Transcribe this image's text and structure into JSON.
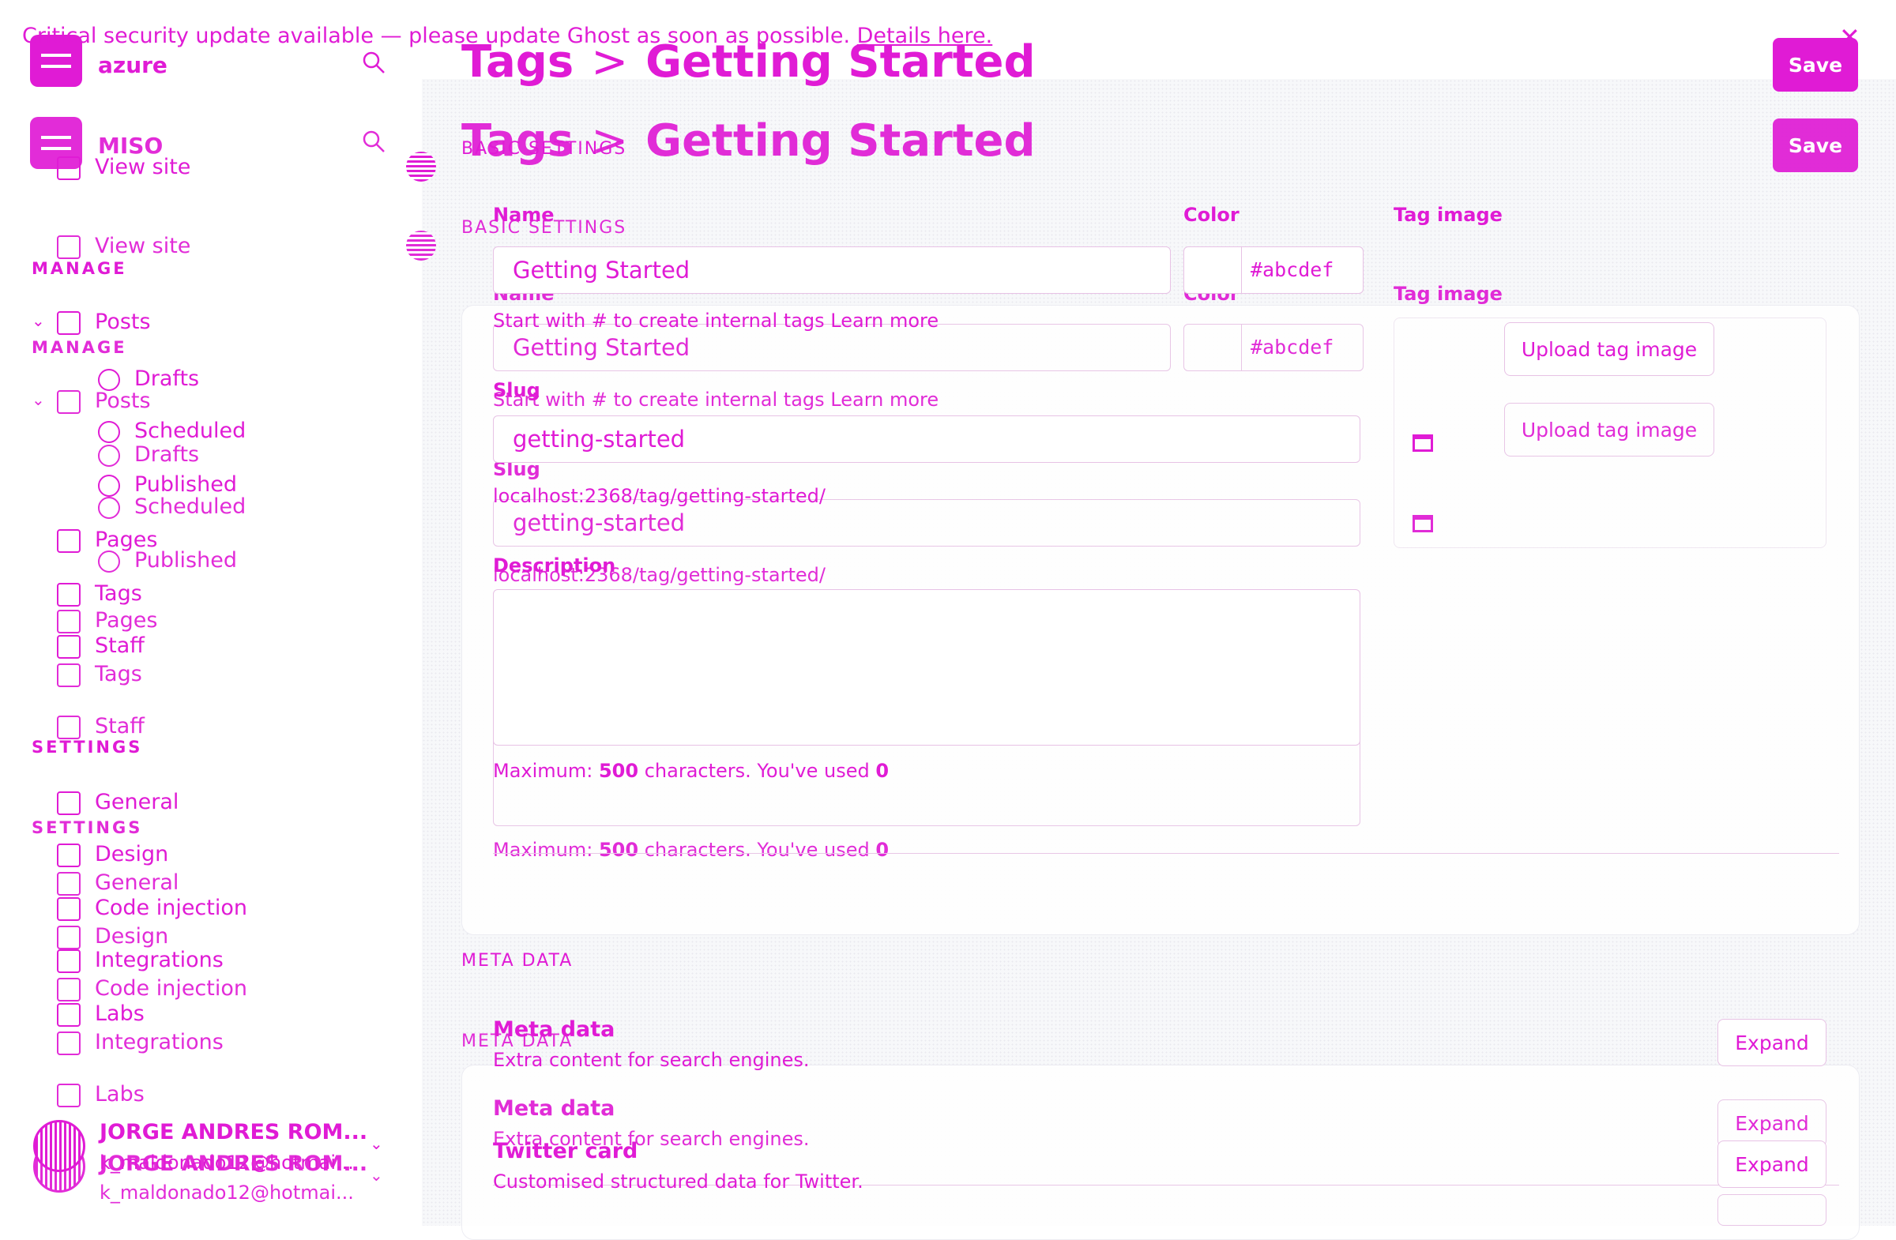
{
  "banner": {
    "text": "Critical security update available — please update Ghost as soon as possible.",
    "link": "Details here.",
    "close_icon": "close-icon"
  },
  "sidebar_primary": {
    "site_name": "azure",
    "view_site": "View site",
    "manage_heading": "MANAGE",
    "posts": "Posts",
    "drafts": "Drafts",
    "scheduled": "Scheduled",
    "published": "Published",
    "pages": "Pages",
    "tags": "Tags",
    "staff": "Staff",
    "settings_heading": "SETTINGS",
    "general": "General",
    "design": "Design",
    "code_injection": "Code injection",
    "integrations": "Integrations",
    "labs": "Labs",
    "user_name": "JORGE ANDRES ROM...",
    "user_email": "k_maldonado12@hotmai..."
  },
  "sidebar_secondary": {
    "site_name": "MISO",
    "view_site": "View site",
    "manage_heading": "MANAGE",
    "posts": "Posts",
    "drafts": "Drafts",
    "scheduled": "Scheduled",
    "published": "Published",
    "pages": "Pages",
    "tags": "Tags",
    "staff": "Staff",
    "settings_heading": "SETTINGS",
    "general": "General",
    "design": "Design",
    "code_injection": "Code injection",
    "integrations": "Integrations",
    "labs": "Labs",
    "user_name": "JORGE ANDRES ROM...",
    "user_email": "k_maldonado12@hotmai..."
  },
  "header": {
    "crumb_parent": "Tags",
    "crumb_sep": ">",
    "crumb_current": "Getting Started",
    "save_label": "Save"
  },
  "basic": {
    "heading": "BASIC SETTINGS",
    "name_label": "Name",
    "name_value": "Getting Started",
    "name_hint": "Start with # to create internal tags Learn more",
    "color_label": "Color",
    "color_value": "#abcdef",
    "image_label": "Tag image",
    "upload_label": "Upload tag image",
    "slug_label": "Slug",
    "slug_value": "getting-started",
    "slug_url": "localhost:2368/tag/getting-started/",
    "description_label": "Description",
    "description_value": "",
    "max_prefix": "Maximum:",
    "max_count": "500",
    "max_middle": "characters. You've used",
    "used_count": "0"
  },
  "meta": {
    "heading": "META DATA",
    "meta_title": "Meta data",
    "meta_desc": "Extra content for search engines.",
    "twitter_title": "Twitter card",
    "twitter_desc": "Customised structured data for Twitter.",
    "expand_label": "Expand"
  },
  "colors": {
    "accent": "#e01bd5",
    "background": "#f7f8fa"
  }
}
